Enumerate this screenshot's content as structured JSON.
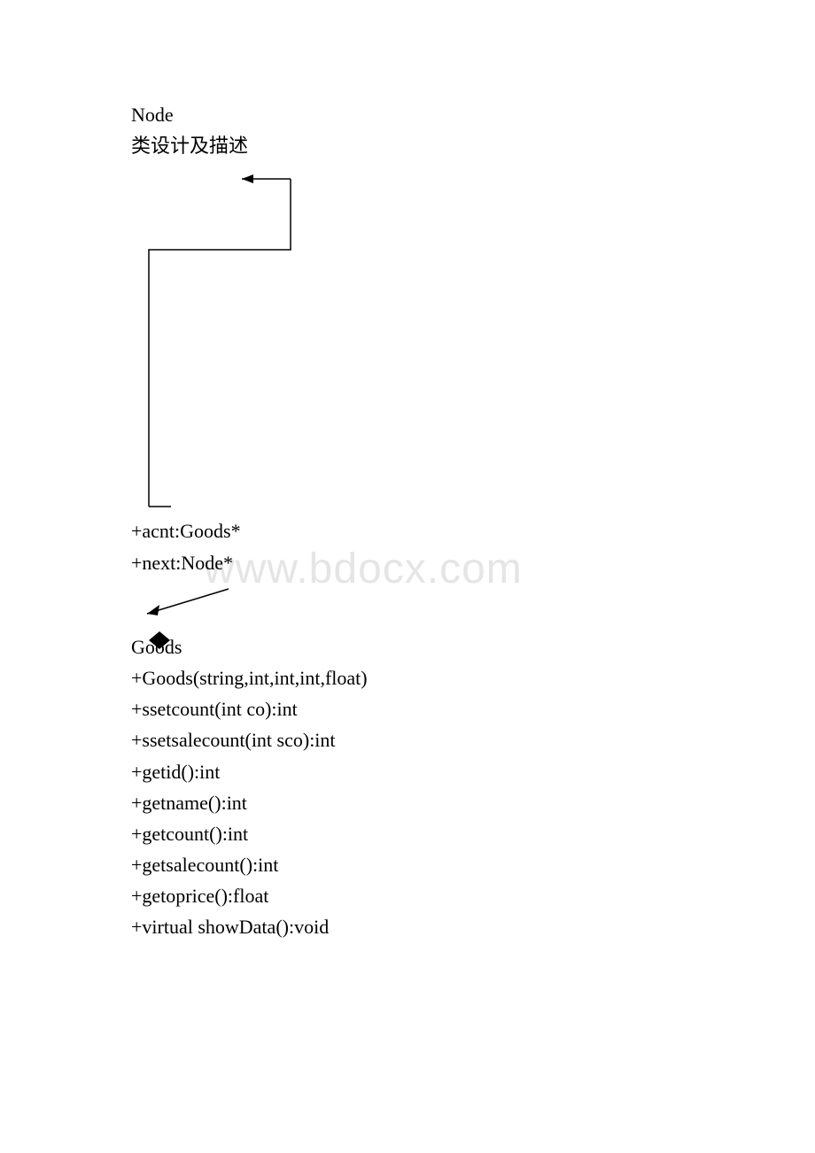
{
  "header": {
    "node_title": " Node",
    "subtitle": "类设计及描述"
  },
  "node_class": {
    "attr1": " +acnt:Goods*",
    "attr2": "+next:Node*"
  },
  "goods_class": {
    "title": " Goods",
    "methods": [
      "+Goods(string,int,int,int,float)",
      "+ssetcount(int co):int",
      "+ssetsalecount(int sco):int",
      "+getid():int",
      "+getname():int",
      "+getcount():int",
      "+getsalecount():int",
      "+getoprice():float",
      "+virtual showData():void"
    ]
  },
  "watermark": "www.bdocx.com"
}
